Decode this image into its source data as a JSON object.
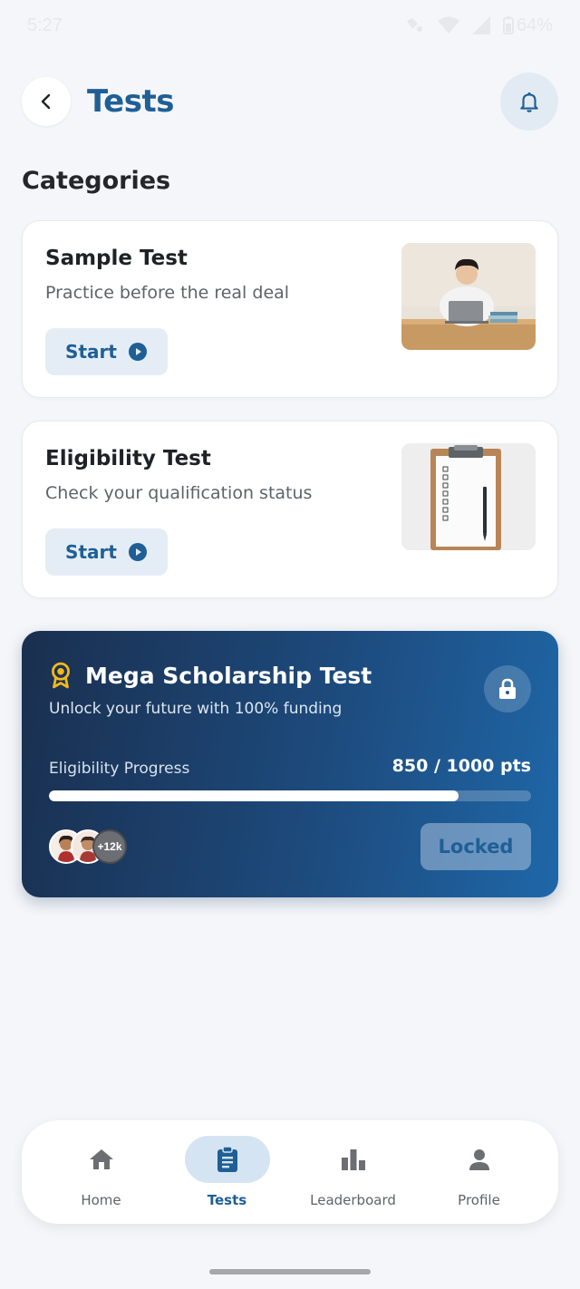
{
  "status_bar": {
    "time": "5:27",
    "battery": "64%"
  },
  "header": {
    "title": "Tests",
    "back_icon": "chevron-left-icon",
    "bell_icon": "bell-icon"
  },
  "section_title": "Categories",
  "tests": [
    {
      "title": "Sample Test",
      "subtitle": "Practice before the real deal",
      "button": "Start"
    },
    {
      "title": "Eligibility Test",
      "subtitle": "Check your qualification status",
      "button": "Start"
    }
  ],
  "mega": {
    "title": "Mega Scholarship Test",
    "subtitle": "Unlock your future with 100% funding",
    "progress_label": "Eligibility Progress",
    "progress_text": "850 / 1000 pts",
    "progress_fraction": 0.85,
    "avatars_more": "+12k",
    "locked_label": "Locked"
  },
  "nav": [
    {
      "label": "Home",
      "icon": "home-icon",
      "active": false
    },
    {
      "label": "Tests",
      "icon": "clipboard-icon",
      "active": true
    },
    {
      "label": "Leaderboard",
      "icon": "bar-chart-icon",
      "active": false
    },
    {
      "label": "Profile",
      "icon": "person-icon",
      "active": false
    }
  ],
  "colors": {
    "accent": "#1f5f96",
    "background": "#f4f6f9",
    "mega_start": "#1a2f4f",
    "mega_end": "#1f67a8",
    "award": "#f5b915"
  }
}
